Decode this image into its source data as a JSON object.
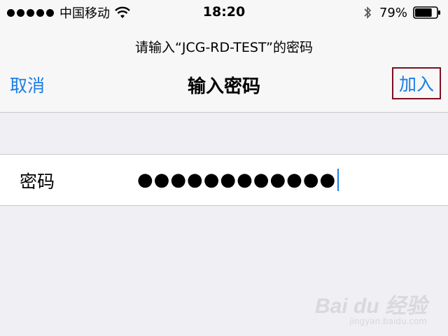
{
  "status_bar": {
    "carrier": "中国移动",
    "time": "18:20",
    "battery_percent": "79%",
    "battery_level": 0.79,
    "icons": [
      "signal-dots",
      "wifi-icon",
      "bluetooth-icon",
      "battery-icon"
    ]
  },
  "nav": {
    "prompt": "请输入“JCG-RD-TEST”的密码",
    "cancel_label": "取消",
    "title": "输入密码",
    "join_label": "加入",
    "accent_color": "#1a7ee6",
    "highlight_color": "#7b1020"
  },
  "form": {
    "password_label": "密码",
    "password_value": "●●●●●●●●●●●●"
  },
  "watermark": {
    "logo": "Bai du 经验",
    "url": "jingyan.baidu.com"
  }
}
